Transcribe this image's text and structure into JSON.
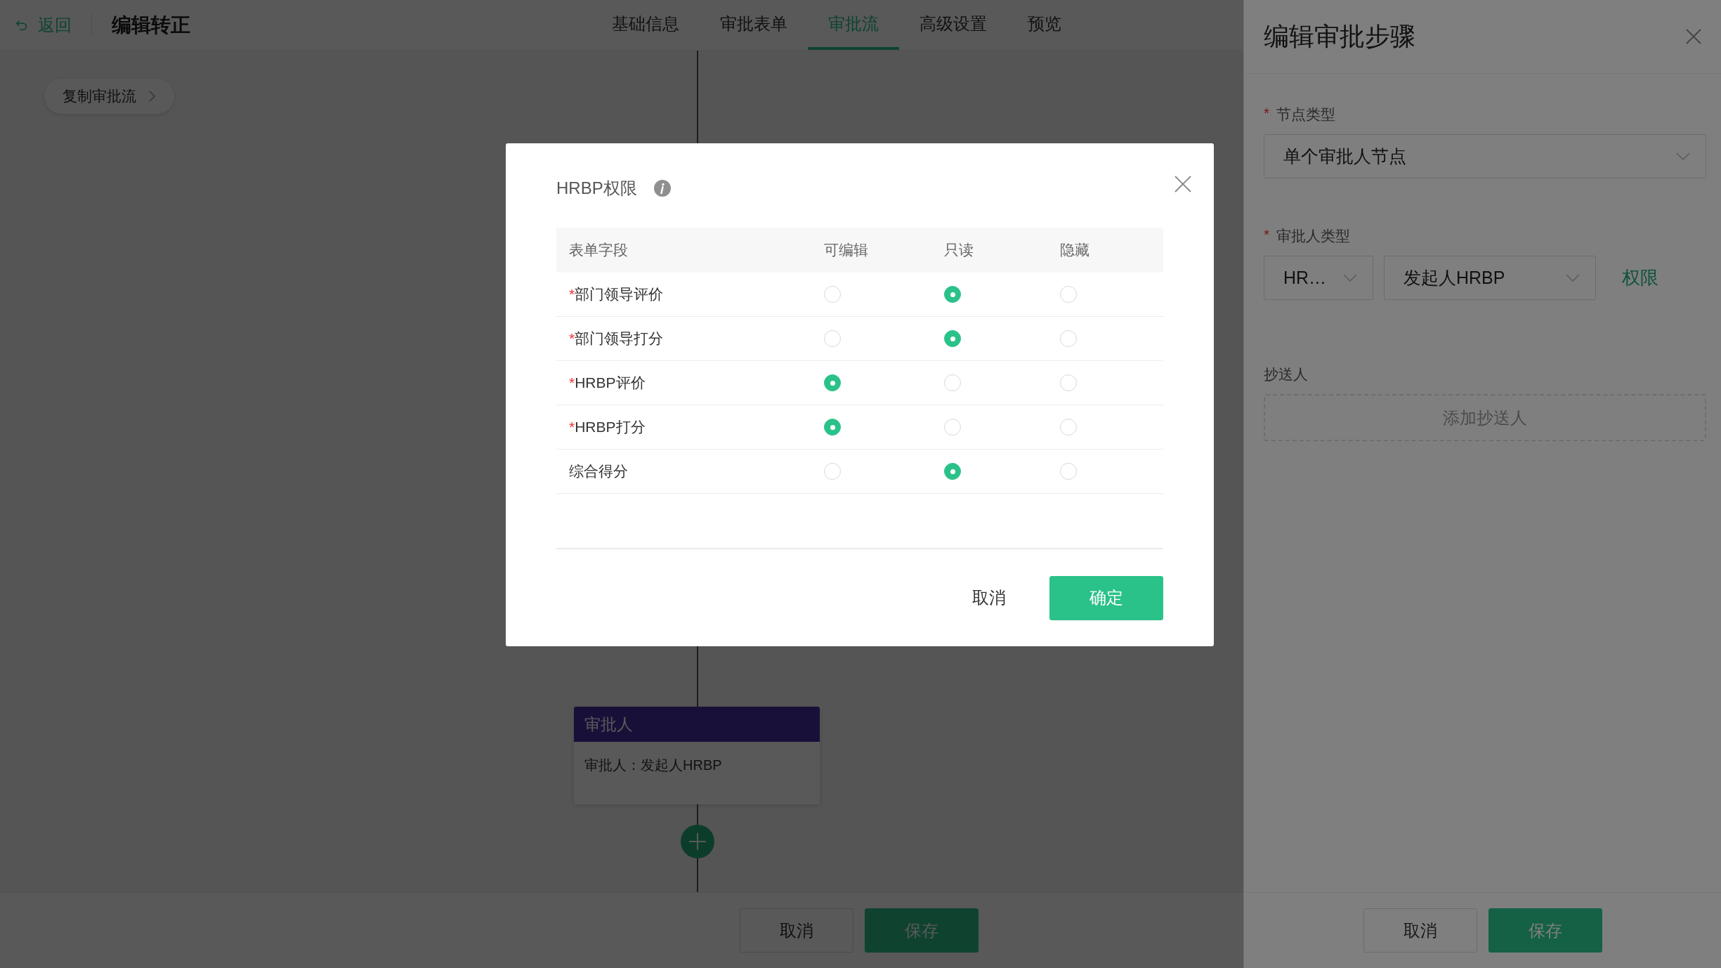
{
  "header": {
    "back": "返回",
    "title": "编辑转正",
    "tabs": [
      {
        "label": "基础信息",
        "selected": false
      },
      {
        "label": "审批表单",
        "selected": false
      },
      {
        "label": "审批流",
        "selected": true
      },
      {
        "label": "高级设置",
        "selected": false
      },
      {
        "label": "预览",
        "selected": false
      }
    ]
  },
  "toolbar": {
    "copy_button": "复制审批流"
  },
  "flow": {
    "node": {
      "title": "审批人",
      "text": "审批人：发起人HRBP"
    }
  },
  "footer": {
    "buttons": [
      {
        "label": "取消",
        "kind": "default"
      },
      {
        "label": "保存",
        "kind": "primary"
      }
    ]
  },
  "drawer": {
    "title": "编辑审批步骤",
    "node_type": {
      "mark": "*",
      "label": "节点类型",
      "value": "单个审批人节点"
    },
    "approver_type": {
      "mark": "*",
      "label": "审批人类型",
      "value": "HR…",
      "value_2": "发起人HRBP",
      "link": "权限"
    },
    "cc": {
      "label": "抄送人",
      "button": "添加抄送人"
    },
    "buttons": [
      {
        "label": "取消",
        "kind": "default"
      },
      {
        "label": "保存",
        "kind": "primary"
      }
    ]
  },
  "dialog": {
    "title": "HRBP权限",
    "columns": [
      "表单字段",
      "可编辑",
      "只读",
      "隐藏"
    ],
    "rows": [
      {
        "mark": "*",
        "label": "部门领导评价",
        "options": [
          {
            "selected": false
          },
          {
            "selected": true
          },
          {
            "selected": false
          }
        ]
      },
      {
        "mark": "*",
        "label": "部门领导打分",
        "options": [
          {
            "selected": false
          },
          {
            "selected": true
          },
          {
            "selected": false
          }
        ]
      },
      {
        "mark": "*",
        "label": "HRBP评价",
        "options": [
          {
            "selected": true
          },
          {
            "selected": false
          },
          {
            "selected": false
          }
        ]
      },
      {
        "mark": "*",
        "label": "HRBP打分",
        "options": [
          {
            "selected": true
          },
          {
            "selected": false
          },
          {
            "selected": false
          }
        ]
      },
      {
        "label": "综合得分",
        "options": [
          {
            "selected": false
          },
          {
            "selected": true
          },
          {
            "selected": false
          }
        ]
      }
    ],
    "buttons": [
      {
        "label": "取消",
        "kind": "text"
      },
      {
        "label": "确定",
        "kind": "primary"
      }
    ]
  }
}
